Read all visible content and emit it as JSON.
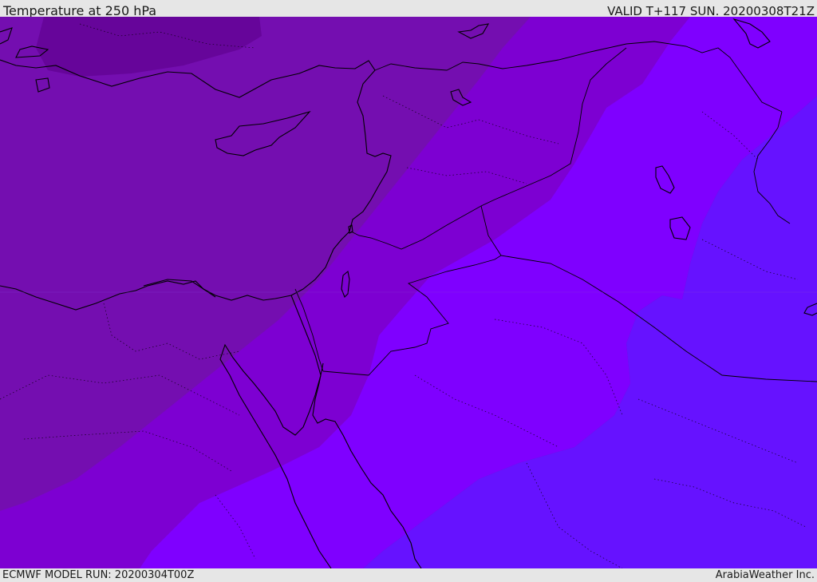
{
  "header": {
    "title": "Temperature at 250 hPa",
    "valid_time": "VALID T+117 SUN. 20200308T21Z"
  },
  "footer": {
    "model_run": "ECMWF MODEL RUN: 20200304T00Z",
    "credit": "ArabiaWeather Inc."
  },
  "map": {
    "colors": {
      "darkest_band": "#66059a",
      "dark_band": "#740eb0",
      "mid_band": "#7d00d2",
      "bright_band": "#7f00ff",
      "blue_band": "#6612ff",
      "land_outline": "#000000"
    }
  }
}
